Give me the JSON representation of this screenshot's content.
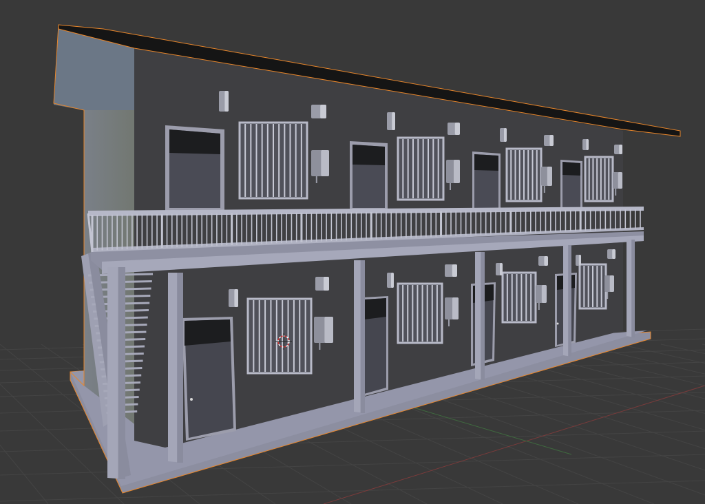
{
  "viewport": {
    "background": "#393939",
    "grid_color": "#444444",
    "x_axis_color": "#7a3b3b",
    "y_axis_color": "#3f6a3f",
    "selection_outline": "#e8862b",
    "cursor_color_red": "#d22d2d",
    "cursor_color_white": "#ffffff"
  },
  "scene": {
    "object": "apartment-building",
    "upper_units": 4,
    "lower_units": 4,
    "stairs": "left-exterior"
  }
}
